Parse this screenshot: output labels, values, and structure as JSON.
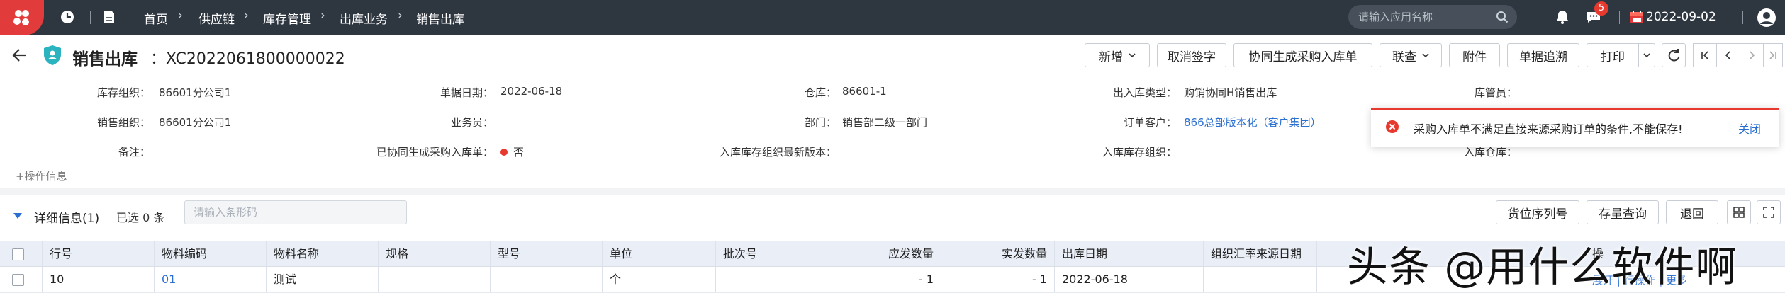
{
  "topbar": {
    "breadcrumbs": [
      "首页",
      "供应链",
      "库存管理",
      "出库业务",
      "销售出库"
    ],
    "search_placeholder": "请输入应用名称",
    "message_badge": "5",
    "date": "2022-09-02"
  },
  "title": {
    "page_title": "销售出库",
    "doc_number": "：XC2022061800000022",
    "buttons": {
      "add": "新增",
      "cancel_sign": "取消签字",
      "gen_purchase_in": "协同生成采购入库单",
      "link_query": "联查",
      "attachment": "附件",
      "trace": "单据追溯",
      "print": "打印"
    }
  },
  "form": {
    "row1": {
      "inv_org_label": "库存组织：",
      "inv_org_value": "86601分公司1",
      "doc_date_label": "单据日期：",
      "doc_date_value": "2022-06-18",
      "warehouse_label": "仓库：",
      "warehouse_value": "86601-1",
      "out_type_label": "出入库类型：",
      "out_type_value": "购销协同H销售出库",
      "keeper_label": "库管员："
    },
    "row2": {
      "sales_org_label": "销售组织：",
      "sales_org_value": "86601分公司1",
      "salesman_label": "业务员：",
      "dept_label": "部门：",
      "dept_value": "销售部二级一部门",
      "customer_label": "订单客户：",
      "customer_value": "866总部版本化（客户集团）"
    },
    "row3": {
      "remark_label": "备注：",
      "generated_label": "已协同生成采购入库单：",
      "generated_value": "否",
      "in_org_version_label": "入库库存组织最新版本：",
      "in_org_label": "入库库存组织：",
      "in_wh_label": "入库仓库："
    },
    "op_info": "+操作信息"
  },
  "detail": {
    "title": "详细信息(1)",
    "selected": "已选 0 条",
    "barcode_placeholder": "请输入条形码",
    "buttons": {
      "location_serial": "货位序列号",
      "stock_query": "存量查询",
      "return": "退回"
    }
  },
  "table": {
    "headers": {
      "row_no": "行号",
      "mat_code": "物料编码",
      "mat_name": "物料名称",
      "spec": "规格",
      "model": "型号",
      "unit": "单位",
      "batch": "批次号",
      "due_qty": "应发数量",
      "actual_qty": "实发数量",
      "out_date": "出库日期",
      "rate_src_date": "组织汇率来源日期",
      "more": "操"
    },
    "rows": [
      {
        "row_no": "10",
        "mat_code": "01",
        "mat_name": "测试",
        "spec": "",
        "model": "",
        "unit": "个",
        "batch": "",
        "due_qty": "- 1",
        "actual_qty": "- 1",
        "out_date": "2022-06-18",
        "rate_src_date": ""
      }
    ],
    "row_links": "展开 | 行操作 | 更多"
  },
  "toast": {
    "message": "采购入库单不满足直接来源采购订单的条件,不能保存!",
    "close": "关闭"
  },
  "watermark": "头条 @用什么软件啊",
  "colors": {
    "topbar_bg": "#2e3640",
    "logo_bg": "#e23b3b",
    "link": "#2a6fd1",
    "error": "#e8392e",
    "table_header_bg": "#e9eef7",
    "doc_icon": "#2bb3c0"
  }
}
